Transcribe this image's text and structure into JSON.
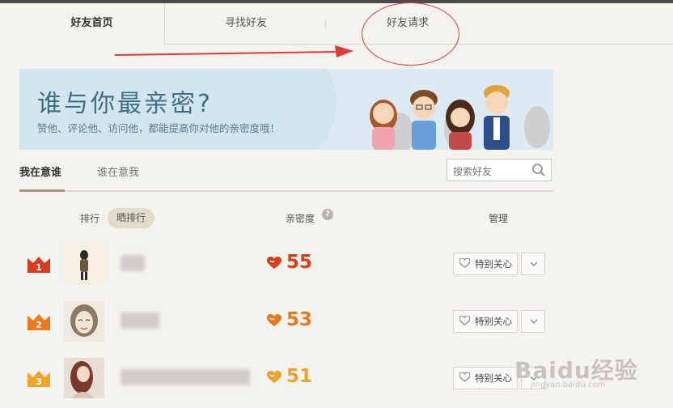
{
  "tabs": [
    {
      "label": "好友首页",
      "active": true
    },
    {
      "label": "寻找好友",
      "active": false
    },
    {
      "label": "好友请求",
      "active": false
    }
  ],
  "banner": {
    "title": "谁与你最亲密?",
    "subtitle": "赞他、评论他、访问他，都能提高你对他的亲密度哦！"
  },
  "subtabs": [
    {
      "label": "我在意谁",
      "active": true
    },
    {
      "label": "谁在意我",
      "active": false
    }
  ],
  "search": {
    "placeholder": "搜索好友",
    "icon": "search-icon"
  },
  "columns": {
    "rank": "排行",
    "share_rank_button": "晒排行",
    "intimacy": "亲密度",
    "manage": "管理"
  },
  "rows": [
    {
      "rank": "1",
      "score": "55",
      "care_label": "特别关心",
      "crown_color": "#d93b1e",
      "score_color": "#d8401c"
    },
    {
      "rank": "2",
      "score": "53",
      "care_label": "特别关心",
      "crown_color": "#ea7a1c",
      "score_color": "#e47a1c"
    },
    {
      "rank": "3",
      "score": "51",
      "care_label": "特别关心",
      "crown_color": "#f0a428",
      "score_color": "#eda22c"
    }
  ],
  "watermark": {
    "main": "Baidu经验",
    "url": "jingyan.baidu.com"
  }
}
